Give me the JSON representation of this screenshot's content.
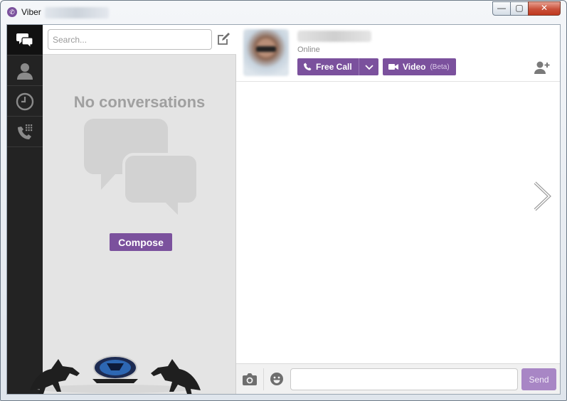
{
  "window": {
    "title": "Viber",
    "controls": {
      "minimize": "—",
      "maximize": "▢",
      "close": "✕"
    }
  },
  "rail": {
    "items": [
      {
        "name": "conversations",
        "icon": "chat-bubbles-icon",
        "active": true
      },
      {
        "name": "contacts",
        "icon": "person-icon",
        "active": false
      },
      {
        "name": "recents",
        "icon": "clock-icon",
        "active": false
      },
      {
        "name": "keypad",
        "icon": "phone-keypad-icon",
        "active": false
      }
    ]
  },
  "conversations": {
    "search_placeholder": "Search...",
    "empty_title": "No conversations",
    "compose_label": "Compose"
  },
  "chat": {
    "status": "Online",
    "free_call_label": "Free Call",
    "video_label": "Video",
    "video_beta": "(Beta)",
    "send_label": "Send",
    "message_value": ""
  },
  "colors": {
    "accent": "#7b519d",
    "rail_bg": "#232323",
    "panel_bg": "#e4e4e4",
    "send_disabled": "#a886c5"
  }
}
